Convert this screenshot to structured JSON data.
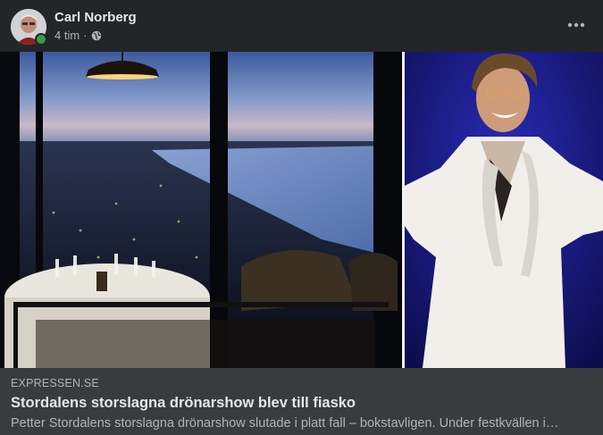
{
  "post": {
    "author": "Carl Norberg",
    "time": "4 tim",
    "separator": "·",
    "privacy_icon": "globe-icon",
    "online": true
  },
  "link": {
    "domain": "EXPRESSEN.SE",
    "title": "Stordalens storslagna drönarshow blev till fiasko",
    "description": "Petter Stordalens storslagna drönarshow slutade i platt fall – bokstavligen. Under festkvällen i…"
  },
  "colors": {
    "background": "#242526",
    "card": "#3a3b3c",
    "text_primary": "#e4e6eb",
    "text_secondary": "#b0b3b8",
    "online": "#31a24c"
  }
}
